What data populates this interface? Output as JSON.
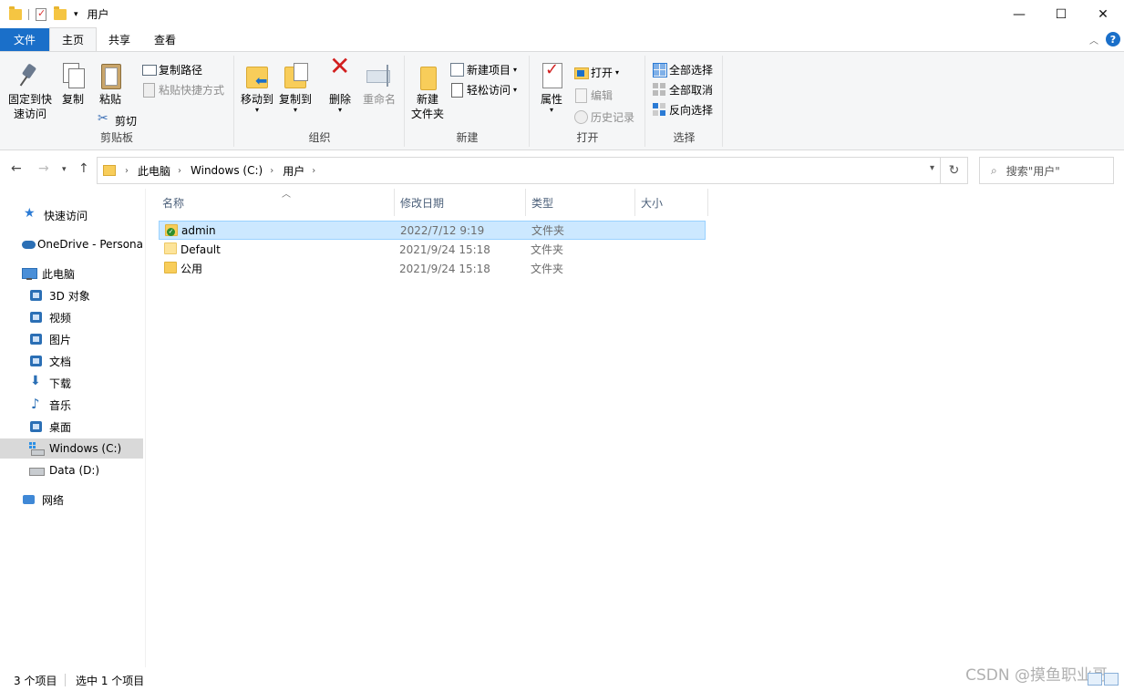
{
  "window": {
    "title": "用户",
    "controls": {
      "minimize": "—",
      "maximize": "☐",
      "close": "✕"
    }
  },
  "ribbon_tabs": [
    {
      "label": "文件"
    },
    {
      "label": "主页"
    },
    {
      "label": "共享"
    },
    {
      "label": "查看"
    }
  ],
  "ribbon": {
    "clipboard": {
      "label": "剪贴板",
      "pin": "固定到快速访问",
      "pin_line1": "固定到快",
      "pin_line2": "速访问",
      "copy": "复制",
      "paste": "粘贴",
      "copy_path": "复制路径",
      "paste_shortcut": "粘贴快捷方式",
      "cut": "剪切"
    },
    "organize": {
      "label": "组织",
      "move_to": "移动到",
      "copy_to": "复制到",
      "delete": "删除",
      "rename": "重命名"
    },
    "new": {
      "label": "新建",
      "new_folder_line1": "新建",
      "new_folder_line2": "文件夹",
      "new_item": "新建项目",
      "easy_access": "轻松访问"
    },
    "open": {
      "label": "打开",
      "properties": "属性",
      "open": "打开",
      "edit": "编辑",
      "history": "历史记录"
    },
    "select": {
      "label": "选择",
      "select_all": "全部选择",
      "select_none": "全部取消",
      "invert": "反向选择"
    }
  },
  "address": {
    "crumbs": [
      "此电脑",
      "Windows (C:)",
      "用户"
    ],
    "search_placeholder": "搜索\"用户\""
  },
  "nav": {
    "quick_access": "快速访问",
    "onedrive": "OneDrive - Persona",
    "this_pc": "此电脑",
    "objects3d": "3D 对象",
    "videos": "视频",
    "pictures": "图片",
    "documents": "文档",
    "downloads": "下载",
    "music": "音乐",
    "desktop": "桌面",
    "windows_c": "Windows (C:)",
    "data_d": "Data (D:)",
    "network": "网络"
  },
  "columns": {
    "name": "名称",
    "modified": "修改日期",
    "type": "类型",
    "size": "大小"
  },
  "files": [
    {
      "name": "admin",
      "modified": "2022/7/12 9:19",
      "type": "文件夹",
      "selected": true
    },
    {
      "name": "Default",
      "modified": "2021/9/24 15:18",
      "type": "文件夹",
      "selected": false
    },
    {
      "name": "公用",
      "modified": "2021/9/24 15:18",
      "type": "文件夹",
      "selected": false
    }
  ],
  "status": {
    "count": "3 个项目",
    "selected": "选中 1 个项目"
  },
  "watermark": "CSDN @摸鱼职业哥",
  "colors": {
    "file_tab": "#1a6fc9",
    "selection_bg": "#cce8ff",
    "selection_border": "#99d1ff",
    "nav_selected": "#d9d9d9",
    "folder": "#f8cd5a"
  }
}
